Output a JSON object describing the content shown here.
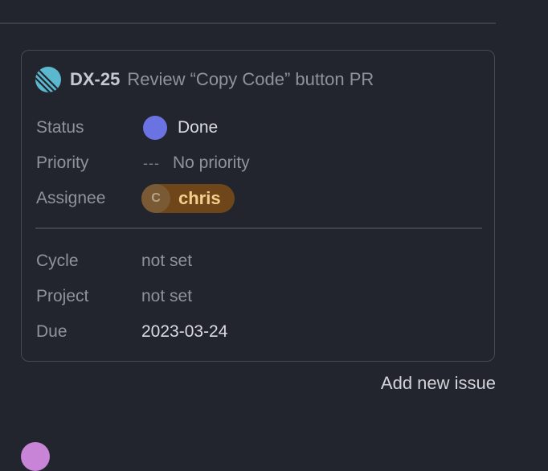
{
  "issue": {
    "id": "DX-25",
    "title": "Review “Copy Code” button PR",
    "team_icon": "linear-team-icon"
  },
  "properties": {
    "status": {
      "label": "Status",
      "value": "Done",
      "color": "#6b73e3",
      "icon": "status-done-icon"
    },
    "priority": {
      "label": "Priority",
      "icon_text": "---",
      "value": "No priority"
    },
    "assignee": {
      "label": "Assignee",
      "initial": "C",
      "name": "chris",
      "pill_color": "#6e461a",
      "name_color": "#f4ce8b"
    },
    "cycle": {
      "label": "Cycle",
      "value": "not set"
    },
    "project": {
      "label": "Project",
      "value": "not set"
    },
    "due": {
      "label": "Due",
      "value": "2023-03-24"
    }
  },
  "actions": {
    "add_issue": "Add new issue"
  },
  "colors": {
    "background": "#22252d",
    "card_border": "#454a54",
    "muted_text": "#8e939d"
  }
}
